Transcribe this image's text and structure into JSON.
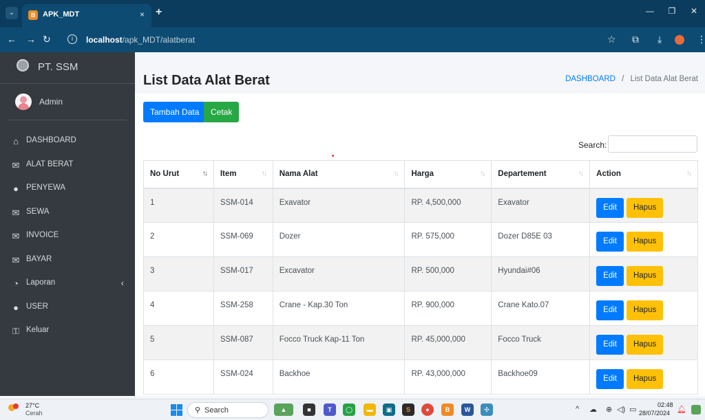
{
  "browser": {
    "tab_title": "APK_MDT",
    "tab_favicon": "B",
    "tab_close": "×",
    "new_tab": "+",
    "url_host": "localhost",
    "url_path": "/apk_MDT/alatberat"
  },
  "sidebar": {
    "brand": "PT. SSM",
    "user": "Admin",
    "items": [
      {
        "label": "DASHBOARD",
        "icon": "home-icon"
      },
      {
        "label": "ALAT BERAT",
        "icon": "envelope-icon"
      },
      {
        "label": "PENYEWA",
        "icon": "user-icon"
      },
      {
        "label": "SEWA",
        "icon": "envelope-icon"
      },
      {
        "label": "INVOICE",
        "icon": "envelope-icon"
      },
      {
        "label": "BAYAR",
        "icon": "envelope-icon"
      },
      {
        "label": "Laporan",
        "icon": "pie-chart-icon"
      },
      {
        "label": "USER",
        "icon": "user-icon"
      },
      {
        "label": "Keluar",
        "icon": "key-icon"
      }
    ]
  },
  "main": {
    "title": "List Data Alat Berat",
    "breadcrumb_link": "DASHBOARD",
    "breadcrumb_sep": "/",
    "breadcrumb_current": "List Data Alat Berat",
    "add_button": "Tambah Data",
    "print_button": "Cetak",
    "search_label": "Search:",
    "search_value": ""
  },
  "table": {
    "headers": [
      "No Urut",
      "Item",
      "Nama Alat",
      "Harga",
      "Departement",
      "Action"
    ],
    "edit_label": "Edit",
    "delete_label": "Hapus",
    "rows": [
      {
        "no": "1",
        "item": "SSM-014",
        "nama": "Exavator",
        "harga": "RP. 4,500,000",
        "dept": "Exavator"
      },
      {
        "no": "2",
        "item": "SSM-069",
        "nama": "Dozer",
        "harga": "RP. 575,000",
        "dept": "Dozer D85E 03"
      },
      {
        "no": "3",
        "item": "SSM-017",
        "nama": "Excavator",
        "harga": "RP. 500,000",
        "dept": "Hyundai#06"
      },
      {
        "no": "4",
        "item": "SSM-258",
        "nama": "Crane - Kap.30 Ton",
        "harga": "RP. 900,000",
        "dept": "Crane Kato.07"
      },
      {
        "no": "5",
        "item": "SSM-087",
        "nama": "Focco Truck Kap-11 Ton",
        "harga": "RP. 45,000,000",
        "dept": "Focco Truck"
      },
      {
        "no": "6",
        "item": "SSM-024",
        "nama": "Backhoe",
        "harga": "RP. 43,000,000",
        "dept": "Backhoe09"
      }
    ]
  },
  "taskbar": {
    "weather_temp": "27°C",
    "weather_desc": "Cerah",
    "search_placeholder": "Search",
    "time": "02:48",
    "date": "28/07/2024"
  },
  "colors": {
    "sidebar_bg": "#343a40",
    "primary": "#007bff",
    "success": "#28a745",
    "warning": "#ffc107",
    "chrome_bg": "#0b3c5d"
  }
}
